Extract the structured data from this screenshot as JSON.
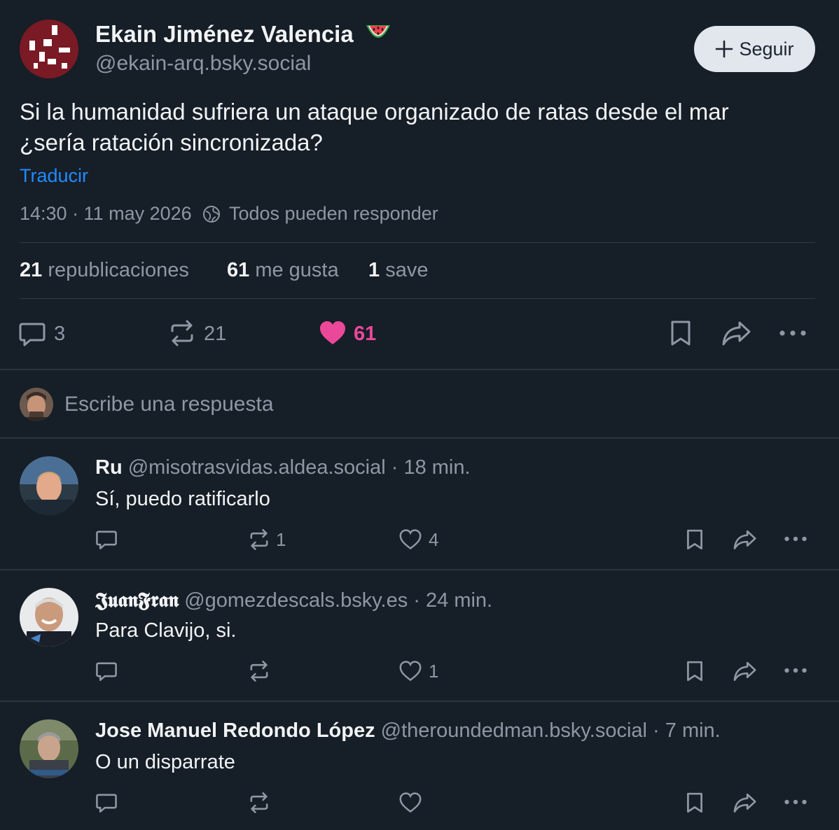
{
  "post": {
    "author_name": "Ekain Jiménez Valencia",
    "author_emoji": "🍉",
    "author_handle": "@ekain-arq.bsky.social",
    "follow_label": "Seguir",
    "text_line1": "Si la humanidad sufriera un ataque organizado de ratas desde el mar",
    "text_line2": "¿sería ratación sincronizada?",
    "translate_label": "Traducir",
    "timestamp": "14:30 · 11 may 2026",
    "reply_setting": "Todos pueden responder",
    "stats": {
      "reposts_count": "21",
      "reposts_label": "republicaciones",
      "likes_count": "61",
      "likes_label": "me gusta",
      "saves_count": "1",
      "saves_label": "save"
    },
    "actions": {
      "replies": "3",
      "reposts": "21",
      "likes": "61"
    }
  },
  "composer": {
    "placeholder": "Escribe una respuesta"
  },
  "replies": [
    {
      "name": "Ru",
      "handle": "@misotrasvidas.aldea.social",
      "time": "· 18 min.",
      "text": "Sí, puedo ratificarlo",
      "reply_count": "",
      "repost_count": "1",
      "like_count": "4"
    },
    {
      "name": "𝕵𝖚𝖆𝖓𝕱𝖗𝖆𝖓",
      "handle": "@gomezdescals.bsky.es",
      "time": "· 24 min.",
      "text": "Para Clavijo, si.",
      "reply_count": "",
      "repost_count": "",
      "like_count": "1"
    },
    {
      "name": "Jose Manuel Redondo López",
      "handle": "@theroundedman.bsky.social",
      "time": "· 7 min.",
      "text": "O un disparrate",
      "reply_count": "",
      "repost_count": "",
      "like_count": ""
    }
  ],
  "colors": {
    "background": "#161e27",
    "link": "#208bfe",
    "like": "#ec4899",
    "muted": "#8d98a5",
    "follow_bg": "#e2e7ee"
  }
}
